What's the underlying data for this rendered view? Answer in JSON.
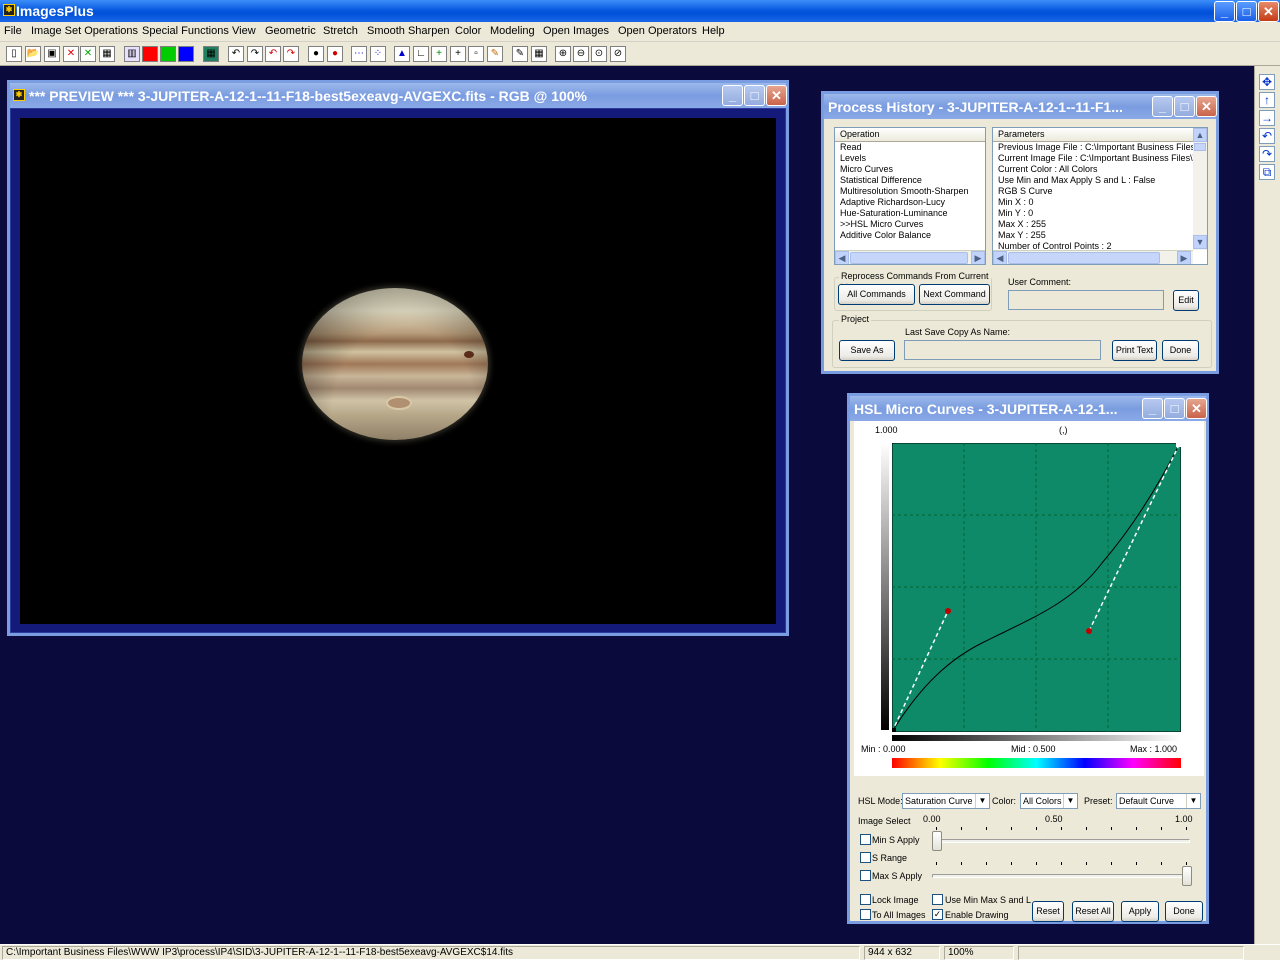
{
  "app": {
    "title": "ImagesPlus"
  },
  "menu": [
    "File",
    "Image Set Operations",
    "Special Functions",
    "View",
    "Geometric",
    "Stretch",
    "Smooth Sharpen",
    "Color",
    "Modeling",
    "Open Images",
    "Open Operators",
    "Help"
  ],
  "toolbar_icons": [
    "new-icon",
    "open-icon",
    "save-icon",
    "close-red-icon",
    "close-green-icon",
    "calc-icon",
    "rgb-icon",
    "red-channel-icon",
    "green-channel-icon",
    "blue-channel-icon",
    "grid-icon",
    "undo-icon",
    "redo-icon",
    "undo-red-icon",
    "redo-red-icon",
    "circle-black-icon",
    "circle-red-icon",
    "dots-icon",
    "points-icon",
    "histogram-icon",
    "axes-icon",
    "crosshair-green-icon",
    "crosshair-icon",
    "grid-small-icon",
    "palette-icon",
    "pencil-icon",
    "table-icon",
    "zoom-in-icon",
    "zoom-out-icon",
    "zoom-fit-icon",
    "zoom-reset-icon"
  ],
  "preview": {
    "title": "*** PREVIEW *** 3-JUPITER-A-12-1--11-F18-best5exeavg-AVGEXC.fits - RGB @  100%"
  },
  "process_history": {
    "title": "Process History - 3-JUPITER-A-12-1--11-F1...",
    "operation_header": "Operation",
    "operations": [
      "Read",
      "Levels",
      "Micro Curves",
      "Statistical Difference",
      "Multiresolution Smooth-Sharpen",
      "Adaptive Richardson-Lucy",
      "Hue-Saturation-Luminance",
      ">>HSL Micro Curves",
      "Additive Color Balance"
    ],
    "parameters_header": "Parameters",
    "parameters": [
      "Previous Image File : C:\\Important Business Files\\W",
      "Current Image File : C:\\Important Business Files\\W",
      "Current Color : All Colors",
      "Use Min and Max Apply S and L : False",
      "RGB S Curve",
      " Min X : 0",
      " Min Y : 0",
      " Max X : 255",
      " Max Y : 255",
      " Number of Control Points : 2"
    ],
    "reprocess_label": "Reprocess Commands From Current >>",
    "all_commands": "All Commands",
    "next_command": "Next Command",
    "user_comment_label": "User Comment:",
    "user_comment_value": "",
    "edit": "Edit",
    "project_label": "Project",
    "last_save_label": "Last Save Copy As Name:",
    "last_save_value": "",
    "save_as": "Save As",
    "print_text": "Print Text",
    "done": "Done"
  },
  "hsl": {
    "title": "HSL Micro Curves - 3-JUPITER-A-12-1...",
    "y_top": "1.000",
    "cursor_readout": "(,)",
    "min_label": "Min :  0.000",
    "mid_label": "Mid :  0.500",
    "max_label": "Max :  1.000",
    "mode_label": "HSL Mode:",
    "mode_value": "Saturation Curve",
    "color_label": "Color:",
    "color_value": "All Colors",
    "preset_label": "Preset:",
    "preset_value": "Default Curve",
    "image_select": "Image Select",
    "scale_0": "0.00",
    "scale_mid": "0.50",
    "scale_1": "1.00",
    "min_s_apply": "Min S Apply",
    "s_range": "S Range",
    "max_s_apply": "Max S Apply",
    "min_s_slider_value": 0.0,
    "max_s_slider_value": 1.0,
    "lock_image": "Lock Image",
    "to_all_images": "To All Images",
    "use_min_max": "Use Min Max S and L",
    "enable_drawing": "Enable Drawing",
    "enable_drawing_checked": true,
    "reset": "Reset",
    "reset_all": "Reset All",
    "apply": "Apply",
    "done": "Done"
  },
  "status": {
    "path": "C:\\Important Business Files\\WWW IP3\\process\\IP4\\SID\\3-JUPITER-A-12-1--11-F18-best5exeavg-AVGEXC$14.fits",
    "size": "944 x 632",
    "zoom": "100%"
  },
  "colors": {
    "desktop": "#0a0a3c",
    "curve_bg": "#0e8a68",
    "control_point": "#c00000"
  }
}
